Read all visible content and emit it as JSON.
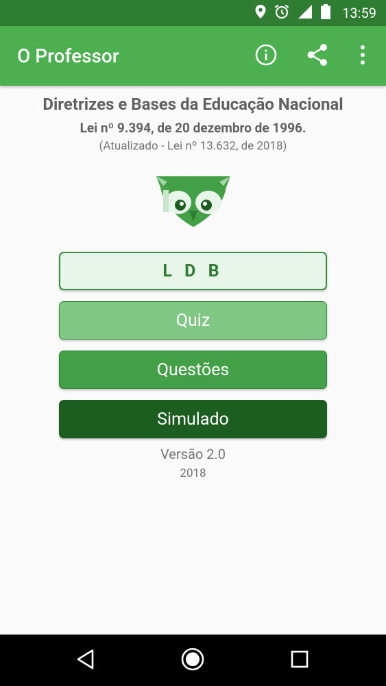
{
  "status_bar": {
    "time": "13:59",
    "icons": [
      "location-icon",
      "alarm-icon",
      "signal-icon",
      "battery-icon"
    ]
  },
  "app_bar": {
    "title": "O Professor",
    "actions": [
      "info-icon",
      "share-icon",
      "more-vert-icon"
    ]
  },
  "header": {
    "title": "Diretrizes e Bases da Educação Nacional",
    "law": "Lei nº 9.394, de 20 dezembro de 1996.",
    "updated": "(Atualizado - Lei nº 13.632, de 2018)"
  },
  "logo": {
    "name": "owl-logo"
  },
  "buttons": {
    "ldb": "L D B",
    "quiz": "Quiz",
    "questoes": "Questões",
    "simulado": "Simulado"
  },
  "footer": {
    "version": "Versão 2.0",
    "year": "2018"
  },
  "nav_bar": [
    "back-icon",
    "home-icon",
    "recents-icon"
  ],
  "colors": {
    "status_bar": "#2e7d32",
    "app_bar": "#4caf50",
    "ldb_bg": "#e8f5e9",
    "quiz_bg": "#81c784",
    "questoes_bg": "#43a047",
    "simulado_bg": "#1b5e20"
  }
}
